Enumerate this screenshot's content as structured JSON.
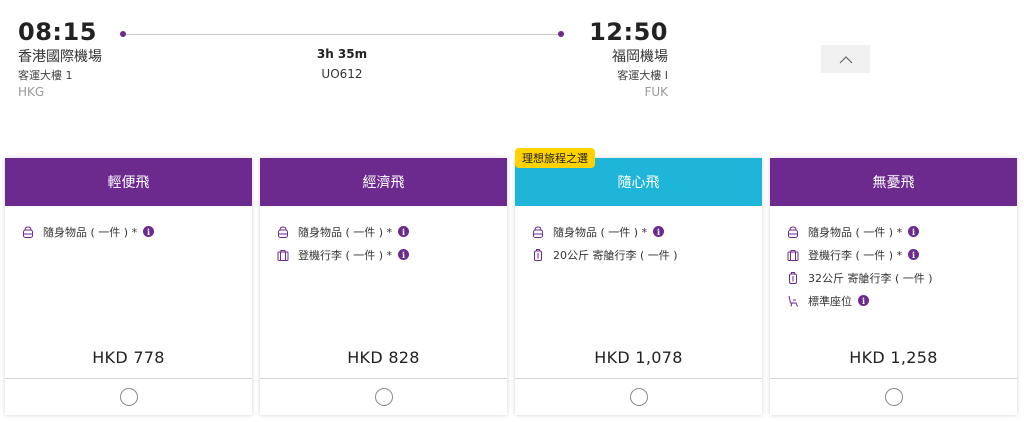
{
  "flight": {
    "departure": {
      "time": "08:15",
      "airport": "香港國際機場",
      "terminal": "客運大樓 1",
      "code": "HKG"
    },
    "arrival": {
      "time": "12:50",
      "airport": "福岡機場",
      "terminal": "客運大樓 I",
      "code": "FUK"
    },
    "duration": "3h 35m",
    "flight_number": "UO612",
    "collapse_icon": "chevron-up-icon"
  },
  "colors": {
    "purple": "#6c2a8f",
    "cyan": "#1fb5d8",
    "badge_yellow": "#ffd200"
  },
  "fares": [
    {
      "name": "輕便飛",
      "header_color": "#6c2a8f",
      "badge": "",
      "features": [
        {
          "icon": "backpack-icon",
          "label": "隨身物品 ( 一件 ) *",
          "info": true
        }
      ],
      "price": "HKD 778"
    },
    {
      "name": "經濟飛",
      "header_color": "#6c2a8f",
      "badge": "",
      "features": [
        {
          "icon": "backpack-icon",
          "label": "隨身物品 ( 一件 ) *",
          "info": true
        },
        {
          "icon": "cabin-bag-icon",
          "label": "登機行李 ( 一件 ) *",
          "info": true
        }
      ],
      "price": "HKD 828"
    },
    {
      "name": "隨心飛",
      "header_color": "#1fb5d8",
      "badge": "理想旅程之選",
      "features": [
        {
          "icon": "backpack-icon",
          "label": "隨身物品 ( 一件 ) *",
          "info": true
        },
        {
          "icon": "suitcase-icon",
          "label": "20公斤 寄艙行李 ( 一件 )",
          "info": false
        }
      ],
      "price": "HKD 1,078"
    },
    {
      "name": "無憂飛",
      "header_color": "#6c2a8f",
      "badge": "",
      "features": [
        {
          "icon": "backpack-icon",
          "label": "隨身物品 ( 一件 ) *",
          "info": true
        },
        {
          "icon": "cabin-bag-icon",
          "label": "登機行李 ( 一件 ) *",
          "info": true
        },
        {
          "icon": "suitcase-icon",
          "label": "32公斤 寄艙行李 ( 一件 )",
          "info": false
        },
        {
          "icon": "seat-icon",
          "label": "標準座位",
          "info": true
        }
      ],
      "price": "HKD 1,258"
    }
  ]
}
